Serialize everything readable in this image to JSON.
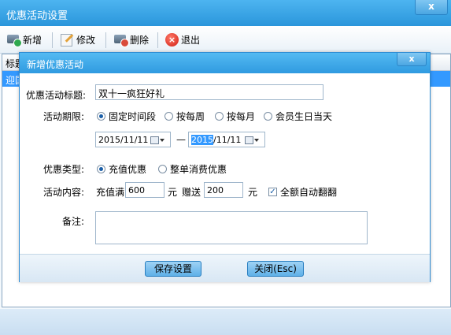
{
  "main": {
    "title": "优惠活动设置",
    "close_label": "x",
    "toolbar": {
      "add_label": "新增",
      "edit_label": "修改",
      "delete_label": "删除",
      "exit_label": "退出"
    },
    "table": {
      "header_partial": "标题",
      "selected_row_partial": "迎国"
    }
  },
  "dialog": {
    "title": "新增优惠活动",
    "close_label": "x",
    "fields": {
      "title_label": "优惠活动标题:",
      "title_value": "双十一疯狂好礼",
      "period_label": "活动期限:",
      "period_options": [
        "固定时间段",
        "按每周",
        "按每月",
        "会员生日当天"
      ],
      "period_selected": "固定时间段",
      "start_date": "2015/11/11",
      "date_separator": "—",
      "end_date_highlight": "2015",
      "end_date_rest": "/11/11",
      "type_label": "优惠类型:",
      "type_options": [
        "充值优惠",
        "整单消费优惠"
      ],
      "type_selected": "充值优惠",
      "content_label": "活动内容:",
      "recharge_full_label": "充值满",
      "recharge_amount": "600",
      "unit_1": "元",
      "bonus_label": "赠送",
      "bonus_amount": "200",
      "unit_2": "元",
      "auto_double_label": "全额自动翻翻",
      "auto_double_checked": true,
      "remark_label": "备注:",
      "remark_value": ""
    },
    "buttons": {
      "save_label": "保存设置",
      "close_label": "关闭(Esc)"
    }
  }
}
